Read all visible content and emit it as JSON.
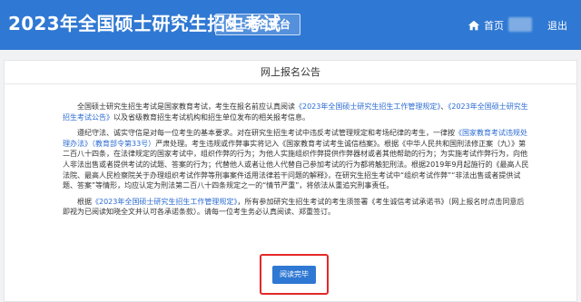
{
  "header": {
    "title": "2023年全国硕士研究生招生考试",
    "platform_tag": "网上报名平台",
    "home_label": "首页",
    "exit_label": "退出"
  },
  "panel": {
    "title": "网上报名公告",
    "p1": {
      "a": "全国硕士研究生招生考试是国家教育考试，考生在报名前应认真阅读",
      "link1": "《2023年全国硕士研究生招生工作管理规定》",
      "b": "、",
      "link2": "《2023年全国硕士研究生招生考试公告》",
      "c": "以及省级教育招生考试机构和招生单位发布的相关报考信息。"
    },
    "p2": {
      "a": "遵纪守法、诚实守信是对每一位考生的基本要求。对在研究生招生考试中违反考试管理规定和考场纪律的考生，一律按",
      "link1": "《国家教育考试违规处理办法》（教育部令第33号）",
      "b": "严肃处理。考生违规或作弊事实将记入《国家教育考试考生诚信档案》。根据《中华人民共和国刑法修正案（九）》第二百八十四条，在法律规定的国家考试中，组织作弊的行为；为他人实施组织作弊提供作弊器材或者其他帮助的行为；为实施考试作弊行为，向他人非法出售或者提供考试的试题、答案的行为；代替他人或者让他人代替自己参加考试的行为都将触犯刑法。根据2019年9月起施行的《最高人民法院、最高人民检察院关于办理组织考试作弊等刑事案件适用法律若干问题的解释》，在研究生招生考试中“组织考试作弊”“非法出售或者提供试题、答案”等情形，均应认定为刑法第二百八十四条规定之一的“情节严重”，将依法从重追究刑事责任。"
    },
    "p3": {
      "a": "根据",
      "link1": "《2023年全国硕士研究生招生工作管理规定》",
      "b": "，所有参加研究生招生考试的考生须签署《考生诚信考试承诺书》（网上报名时点击同意后即视为已阅读知晓全文并认可各承诺条款）。请每一位考生务必认真阅读、郑重签订。"
    },
    "agree_button": "阅读完毕"
  },
  "colors": {
    "brand_blue": "#2f78d3",
    "link_blue": "#2b6bd2",
    "highlight_red": "#e32828"
  },
  "icons": {
    "home": "home-icon"
  }
}
